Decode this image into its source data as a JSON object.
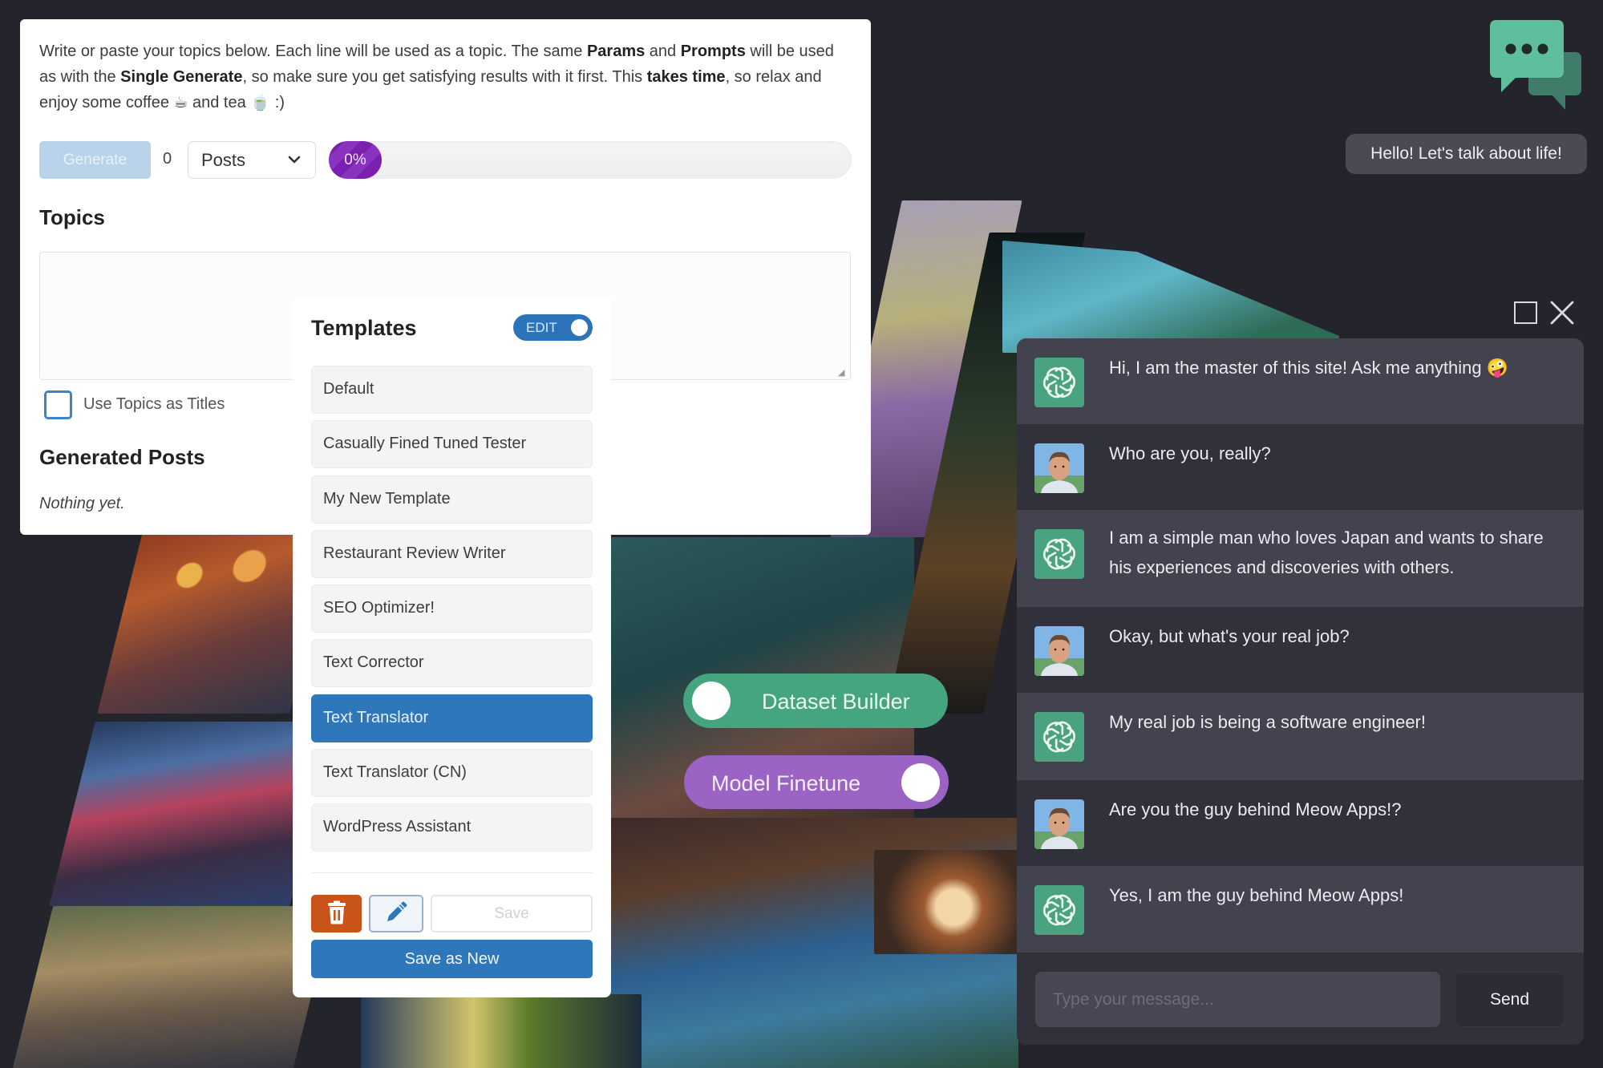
{
  "generator": {
    "description": {
      "p1": "Write or paste your topics below. Each line will be used as a topic. The same ",
      "b1": "Params",
      "p2": " and ",
      "b2": "Prompts",
      "p3": " will be used as with the ",
      "b3": "Single Generate",
      "p4": ", so make sure you get satisfying results with it first. This ",
      "b4": "takes time",
      "p5": ", so relax and enjoy some coffee ",
      "coffee_emoji": "☕",
      "p6": " and tea ",
      "tea_emoji": "🍵",
      "p7": " :)"
    },
    "generate_label": "Generate",
    "count": "0",
    "post_type": "Posts",
    "progress_label": "0%",
    "progress_percent": 0,
    "topics_heading": "Topics",
    "topics_value": "",
    "use_topics_as_titles_label": "Use Topics as Titles",
    "use_topics_as_titles_checked": false,
    "generated_heading": "Generated Posts",
    "generated_empty": "Nothing yet."
  },
  "templates": {
    "title": "Templates",
    "edit_toggle_label": "EDIT",
    "edit_enabled": true,
    "items": [
      {
        "label": "Default",
        "active": false
      },
      {
        "label": "Casually Fined Tuned Tester",
        "active": false
      },
      {
        "label": "My New Template",
        "active": false
      },
      {
        "label": "Restaurant Review Writer",
        "active": false
      },
      {
        "label": "SEO Optimizer!",
        "active": false
      },
      {
        "label": "Text Corrector",
        "active": false
      },
      {
        "label": "Text Translator",
        "active": true
      },
      {
        "label": "Text Translator (CN)",
        "active": false
      },
      {
        "label": "WordPress Assistant",
        "active": false
      }
    ],
    "save_label": "Save",
    "save_new_label": "Save as New"
  },
  "pills": {
    "dataset_builder": "Dataset Builder",
    "model_finetune": "Model Finetune"
  },
  "chat": {
    "hello_bubble": "Hello! Let's talk about life!",
    "messages": [
      {
        "role": "ai",
        "text": "Hi, I am the master of this site! Ask me anything 🤪"
      },
      {
        "role": "user",
        "text": "Who are you, really?"
      },
      {
        "role": "ai",
        "text": "I am a simple man who loves Japan and wants to share his experiences and discoveries with others."
      },
      {
        "role": "user",
        "text": "Okay, but what's your real job?"
      },
      {
        "role": "ai",
        "text": "My real job is being a software engineer!"
      },
      {
        "role": "user",
        "text": "Are you the guy behind Meow Apps!?"
      },
      {
        "role": "ai",
        "text": "Yes, I am the guy behind Meow Apps!"
      }
    ],
    "input_placeholder": "Type your message...",
    "send_label": "Send"
  },
  "colors": {
    "primary_blue": "#2e77bb",
    "danger_orange": "#c8541a",
    "progress_purple": "#7a1fb0",
    "dataset_green": "#44a57f",
    "finetune_purple": "#9a63c4",
    "chat_bg": "#31313b"
  }
}
